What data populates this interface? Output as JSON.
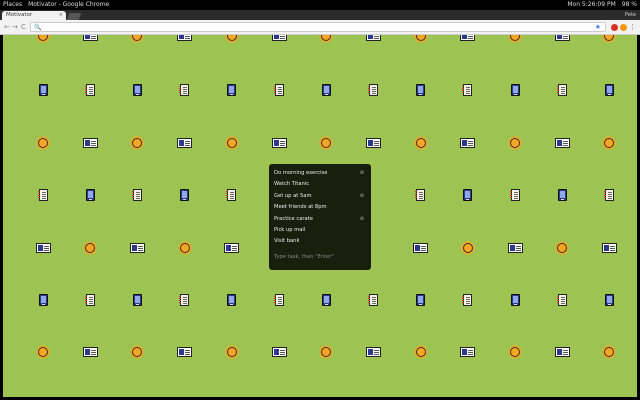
{
  "os_bar": {
    "places": "Places",
    "window_title": "Motivator - Google Chrome",
    "clock": "Mon 5:26:09 PM",
    "battery": "98 %"
  },
  "browser": {
    "tab_title": "Motivator",
    "tab_close": "×",
    "user_name": "Pete",
    "search_icon": "🔍",
    "star_icon": "★",
    "back_icon": "←",
    "forward_icon": "→",
    "reload_icon": "C",
    "menu_icon": "⋮",
    "ext_colors": [
      "#d93025",
      "#f29900",
      "#e8710a"
    ]
  },
  "page": {
    "background": "#9dc352"
  },
  "todo": {
    "items": [
      {
        "label": "Do morning exercise",
        "remove_icon": "⊘"
      },
      {
        "label": "Watch Titanic",
        "remove_icon": ""
      },
      {
        "label": "Get up at 5am",
        "remove_icon": "⊘"
      },
      {
        "label": "Meet friends at 8pm",
        "remove_icon": ""
      },
      {
        "label": "Practice carate",
        "remove_icon": "⊘"
      },
      {
        "label": "Pick up mail",
        "remove_icon": ""
      },
      {
        "label": "Visit bank",
        "remove_icon": ""
      }
    ],
    "placeholder": "Type task, then \"Enter\""
  }
}
